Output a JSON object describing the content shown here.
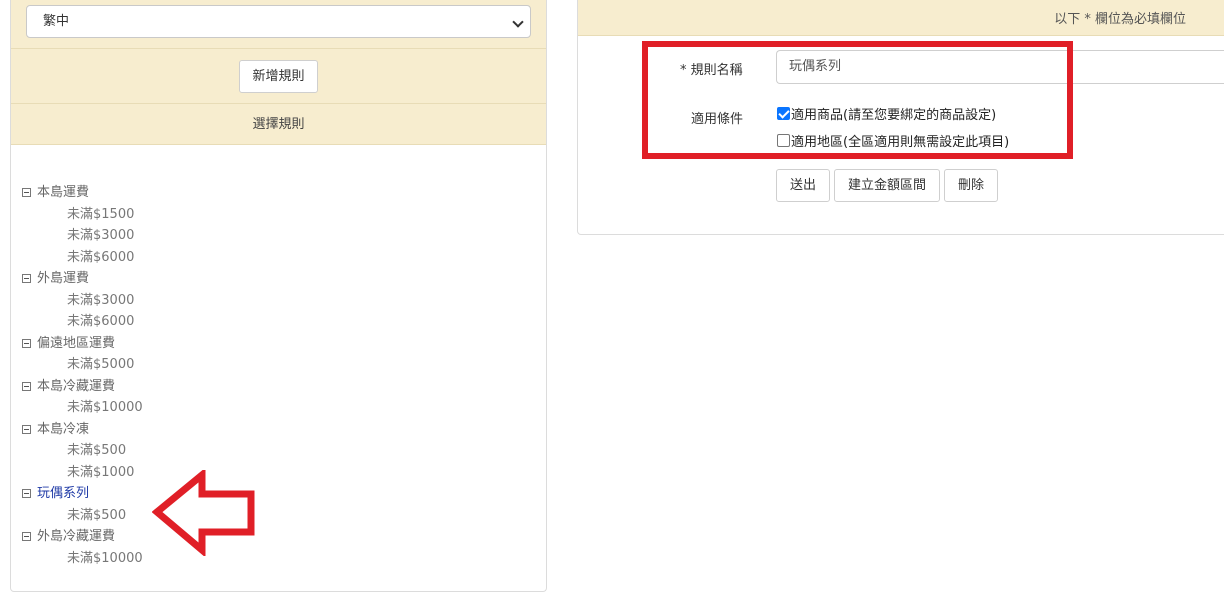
{
  "language": {
    "selected": "繁中"
  },
  "left": {
    "add_rule_button": "新增規則",
    "select_rule_header": "選擇規則"
  },
  "tree": [
    {
      "label": "本島運費",
      "children": [
        "未滿$1500",
        "未滿$3000",
        "未滿$6000"
      ]
    },
    {
      "label": "外島運費",
      "children": [
        "未滿$3000",
        "未滿$6000"
      ]
    },
    {
      "label": "偏遠地區運費",
      "children": [
        "未滿$5000"
      ]
    },
    {
      "label": "本島冷藏運費",
      "children": [
        "未滿$10000"
      ]
    },
    {
      "label": "本島冷凍",
      "children": [
        "未滿$500",
        "未滿$1000"
      ]
    },
    {
      "label": "玩偶系列",
      "active": true,
      "children": [
        "未滿$500"
      ]
    },
    {
      "label": "外島冷藏運費",
      "children": [
        "未滿$10000"
      ]
    }
  ],
  "form": {
    "required_note": "以下 * 欄位為必填欄位",
    "rule_name_label": "* 規則名稱",
    "rule_name_value": "玩偶系列",
    "condition_label": "適用條件",
    "condition_product": "適用商品(請至您要綁定的商品設定)",
    "condition_product_checked": true,
    "condition_region": "適用地區(全區適用則無需設定此項目)",
    "condition_region_checked": false,
    "submit_button": "送出",
    "amount_range_button": "建立金額區間",
    "delete_button": "刪除"
  },
  "colors": {
    "header_bg": "#f7edcf",
    "annotation_red": "#e01f27",
    "active_link": "#1f3aa6",
    "checkbox_blue": "#0a75ff"
  }
}
